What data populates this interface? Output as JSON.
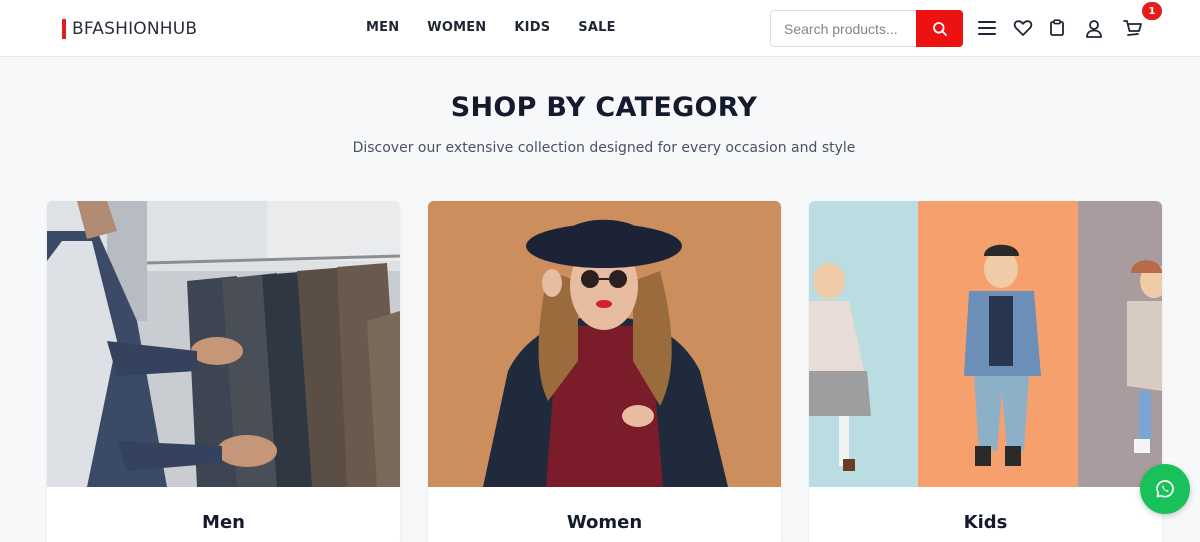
{
  "brand": {
    "name": "BFASHIONHUB",
    "accent": "#e11d1d"
  },
  "nav": {
    "items": [
      "MEN",
      "WOMEN",
      "KIDS",
      "SALE"
    ]
  },
  "search": {
    "placeholder": "Search products...",
    "value": ""
  },
  "header_icons": [
    "menu-icon",
    "heart-icon",
    "clipboard-icon",
    "user-icon",
    "cart-icon"
  ],
  "cart": {
    "count": "1"
  },
  "section": {
    "title": "SHOP BY CATEGORY",
    "subtitle": "Discover our extensive collection designed for every occasion and style"
  },
  "categories": [
    {
      "label": "Men"
    },
    {
      "label": "Women"
    },
    {
      "label": "Kids"
    }
  ],
  "colors": {
    "search_button": "#ee1111",
    "whatsapp": "#19c15a",
    "badge": "#e61b1b"
  }
}
